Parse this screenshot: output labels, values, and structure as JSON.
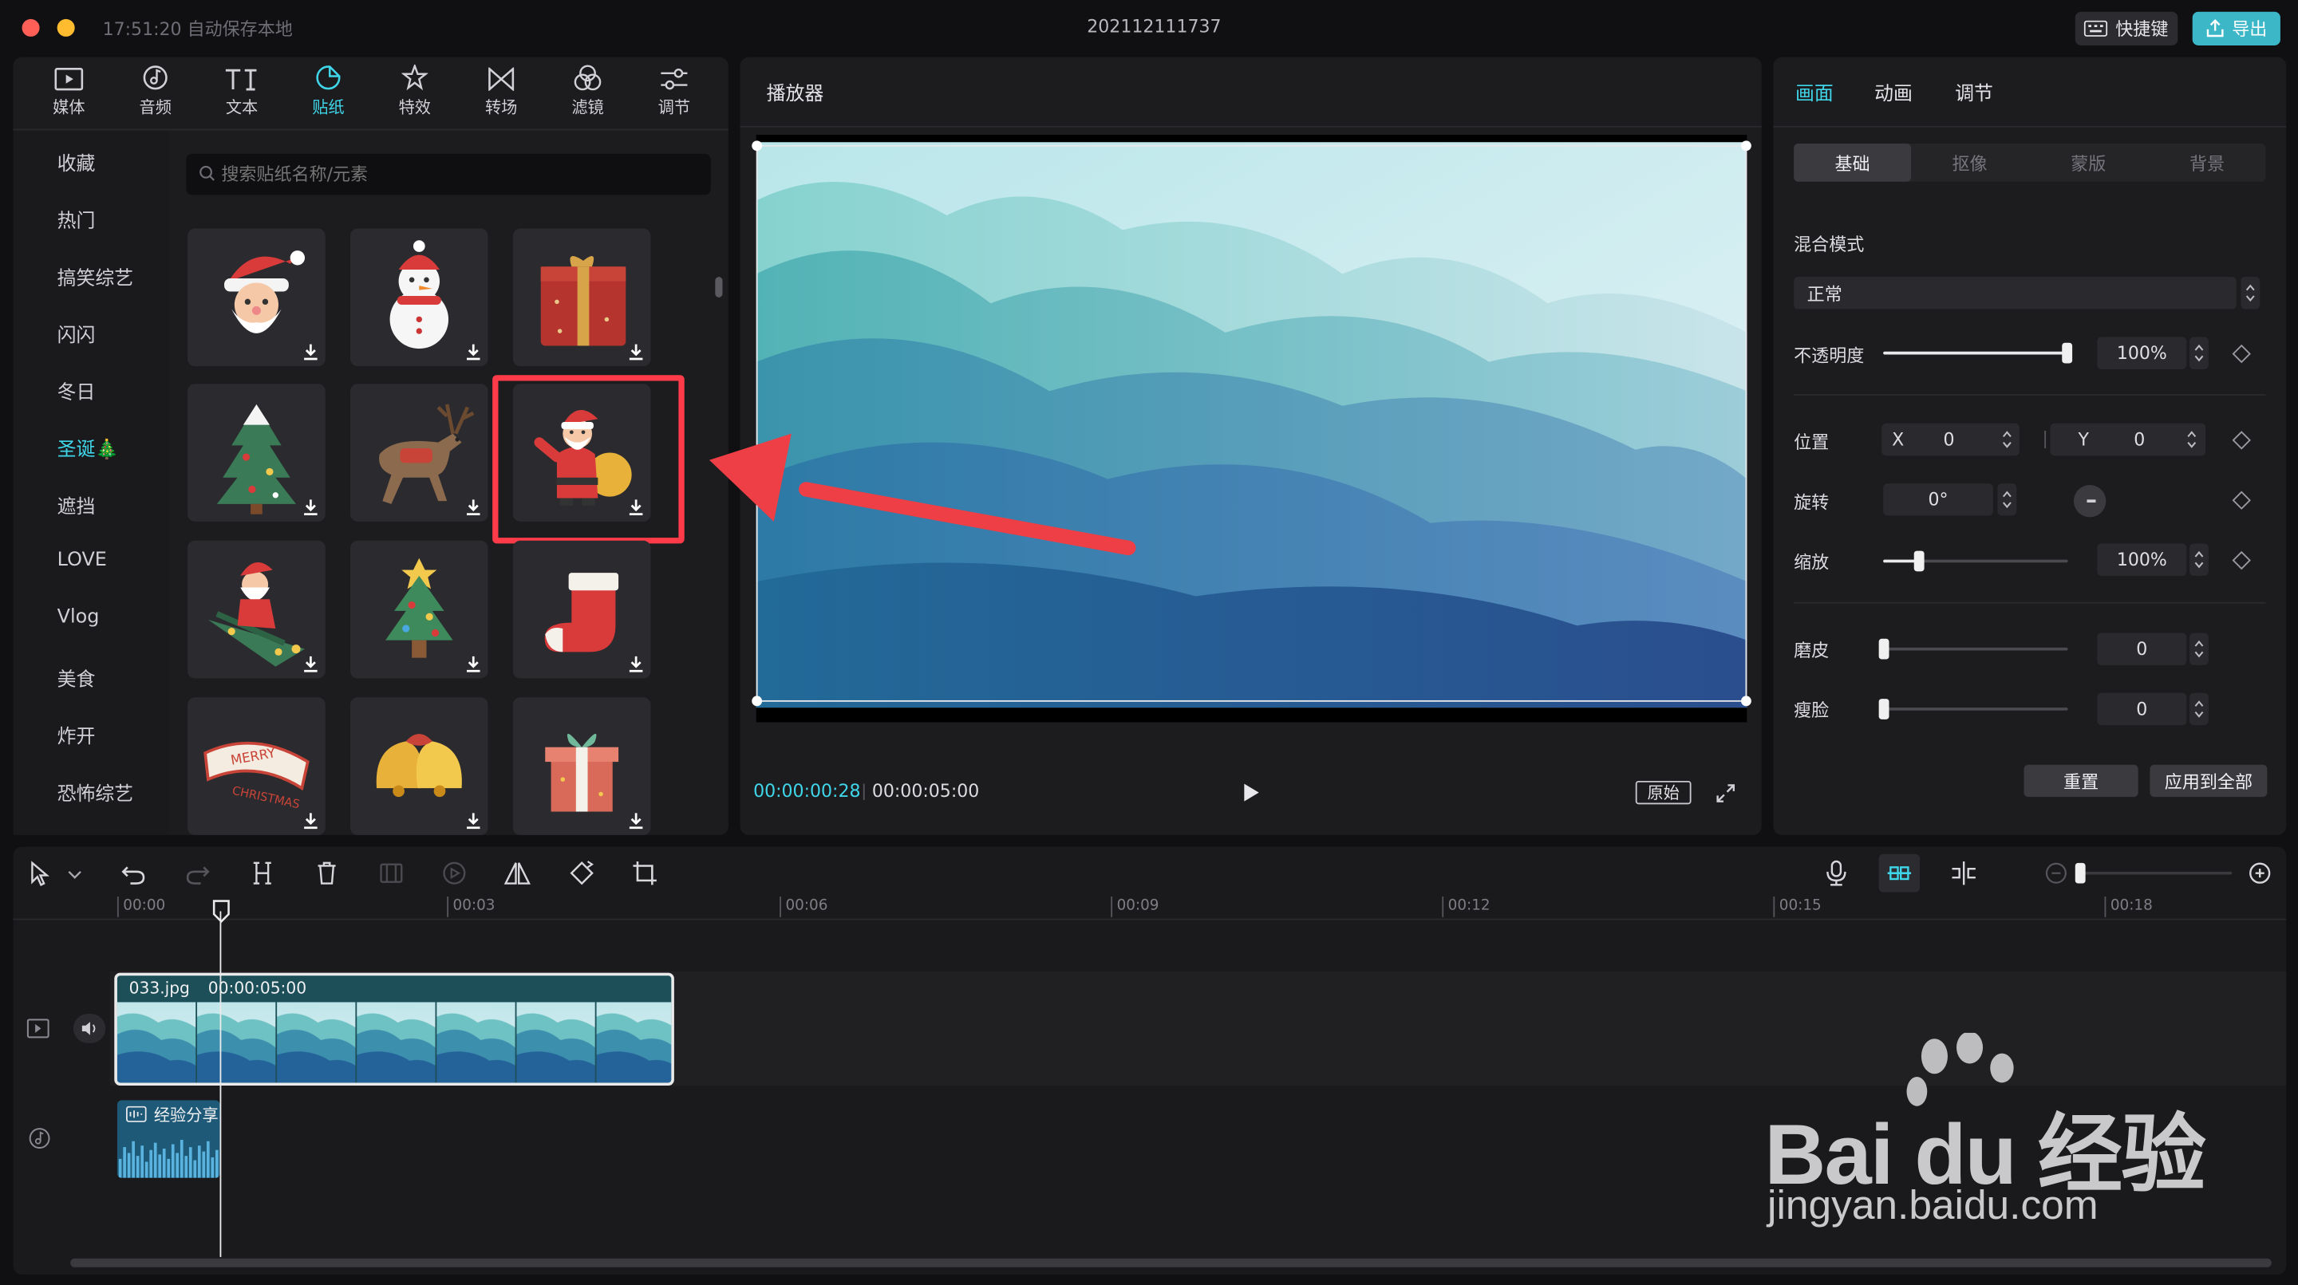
{
  "window": {
    "save_status": "17:51:20 自动保存本地",
    "project_title": "202112111737",
    "shortcut_label": "快捷键",
    "export_label": "导出"
  },
  "toolbar": {
    "items": [
      {
        "label": "媒体",
        "icon": "media-icon"
      },
      {
        "label": "音频",
        "icon": "audio-icon"
      },
      {
        "label": "文本",
        "icon": "text-icon"
      },
      {
        "label": "贴纸",
        "icon": "sticker-icon",
        "active": true
      },
      {
        "label": "特效",
        "icon": "effects-icon"
      },
      {
        "label": "转场",
        "icon": "transition-icon"
      },
      {
        "label": "滤镜",
        "icon": "filter-icon"
      },
      {
        "label": "调节",
        "icon": "adjust-icon"
      }
    ]
  },
  "categories": {
    "items": [
      "收藏",
      "热门",
      "搞笑综艺",
      "闪闪",
      "冬日",
      "圣诞🎄",
      "遮挡",
      "LOVE",
      "Vlog",
      "美食",
      "炸开",
      "恐怖综艺"
    ],
    "active_index": 5
  },
  "stickers": {
    "search_placeholder": "搜索贴纸名称/元素",
    "items": [
      "santa-face",
      "snowman",
      "gift-box",
      "christmas-tree-snow",
      "reindeer",
      "santa-with-sack",
      "santa-on-tree",
      "decorated-tree",
      "christmas-stocking",
      "merry-christmas-ribbon",
      "golden-bells",
      "present"
    ],
    "selected_index": 5
  },
  "player": {
    "title": "播放器",
    "current_time": "00:00:00:28",
    "total_time": "00:00:05:00",
    "ratio_label": "原始"
  },
  "inspector": {
    "tabs": [
      "画面",
      "动画",
      "调节"
    ],
    "active_tab": 0,
    "subtabs": [
      "基础",
      "抠像",
      "蒙版",
      "背景"
    ],
    "active_subtab": 0,
    "blend_label": "混合模式",
    "blend_value": "正常",
    "opacity_label": "不透明度",
    "opacity_value": "100%",
    "opacity_level": 1.0,
    "position_label": "位置",
    "x_label": "X",
    "x_value": "0",
    "y_label": "Y",
    "y_value": "0",
    "rotation_label": "旋转",
    "rotation_value": "0°",
    "scale_label": "缩放",
    "scale_value": "100%",
    "scale_level": 0.19,
    "smooth_label": "磨皮",
    "smooth_value": "0",
    "slim_label": "瘦脸",
    "slim_value": "0",
    "reset_label": "重置",
    "apply_all_label": "应用到全部"
  },
  "timeline": {
    "ticks": [
      "00:00",
      "00:03",
      "00:06",
      "00:09",
      "00:12",
      "00:15",
      "00:18"
    ],
    "clip_name": "033.jpg",
    "clip_duration": "00:00:05:00",
    "audio_clip_label": "经验分享"
  },
  "watermark": {
    "brand": "Bai du 经验",
    "url": "jingyan.baidu.com"
  },
  "colors": {
    "accent": "#3fd6ea",
    "highlight": "#ff3b4a",
    "bg": "#101013",
    "panel": "#1c1c1f"
  }
}
